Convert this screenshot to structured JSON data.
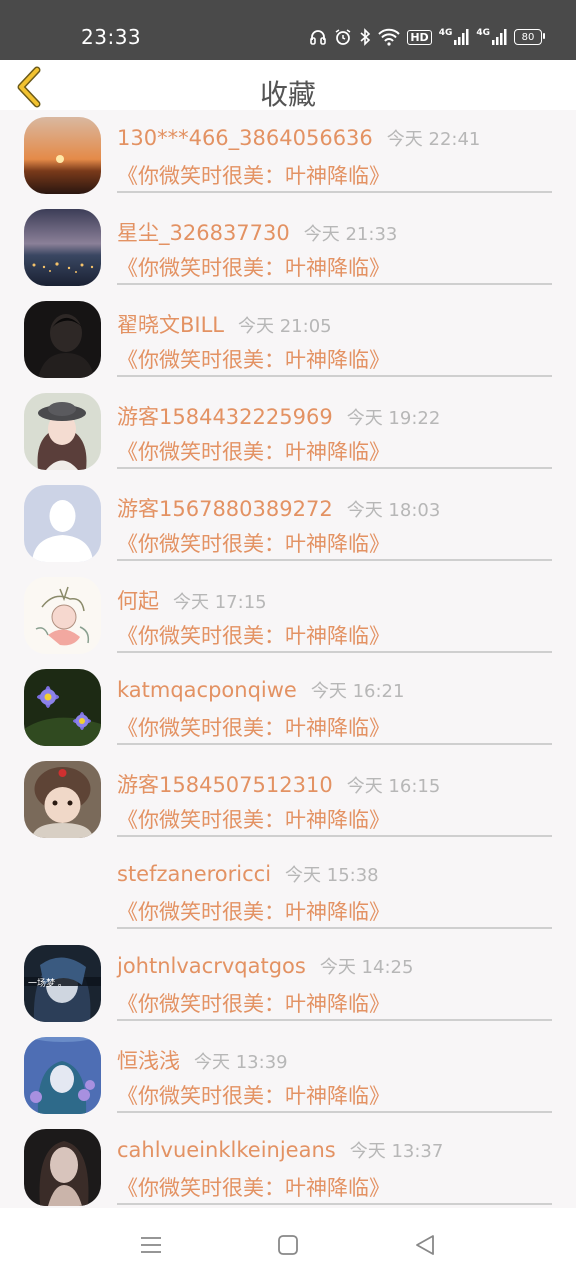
{
  "status_bar": {
    "time": "23:33",
    "hd_label": "HD",
    "net1": "4G",
    "net2": "4G",
    "battery": "80",
    "icons": [
      "headphones-icon",
      "alarm-icon",
      "bluetooth-icon",
      "wifi-icon",
      "hd-icon",
      "signal-icon",
      "signal-icon",
      "battery-icon"
    ]
  },
  "header": {
    "back_icon": "chevron-left-icon",
    "title": "收藏",
    "accent_color": "#e39263"
  },
  "favorites": [
    {
      "name": "130***466_3864056636",
      "time": "今天 22:41",
      "book": "《你微笑时很美：叶神降临》",
      "avatar": "sunset"
    },
    {
      "name": "星尘_326837730",
      "time": "今天 21:33",
      "book": "《你微笑时很美：叶神降临》",
      "avatar": "night-city"
    },
    {
      "name": "翟晓文BILL",
      "time": "今天 21:05",
      "book": "《你微笑时很美：叶神降临》",
      "avatar": "dark-portrait"
    },
    {
      "name": "游客1584432225969",
      "time": "今天 19:22",
      "book": "《你微笑时很美：叶神降临》",
      "avatar": "girl-hat"
    },
    {
      "name": "游客1567880389272",
      "time": "今天 18:03",
      "book": "《你微笑时很美：叶神降临》",
      "avatar": "default-person"
    },
    {
      "name": "何起",
      "time": "今天 17:15",
      "book": "《你微笑时很美：叶神降临》",
      "avatar": "anime-sketch"
    },
    {
      "name": "katmqacponqiwe",
      "time": "今天 16:21",
      "book": "《你微笑时很美：叶神降临》",
      "avatar": "purple-flowers"
    },
    {
      "name": "游客1584507512310",
      "time": "今天 16:15",
      "book": "《你微笑时很美：叶神降临》",
      "avatar": "baby-hat"
    },
    {
      "name": "stefzaneroricci",
      "time": "今天 15:38",
      "book": "《你微笑时很美：叶神降临》",
      "avatar": "none"
    },
    {
      "name": "johtnlvacrvqatgos",
      "time": "今天 14:25",
      "book": "《你微笑时很美：叶神降临》",
      "avatar": "anime-dream",
      "avatar_caption": "一场梦 。"
    },
    {
      "name": "恒浅浅",
      "time": "今天 13:39",
      "book": "《你微笑时很美：叶神降临》",
      "avatar": "anime-blue"
    },
    {
      "name": "cahlvueinklkeinjeans",
      "time": "今天 13:37",
      "book": "《你微笑时很美：叶神降临》",
      "avatar": "woman-portrait"
    }
  ],
  "nav_bar": {
    "menu_icon": "menu-icon",
    "home_icon": "home-square-icon",
    "back_icon": "back-triangle-icon"
  }
}
